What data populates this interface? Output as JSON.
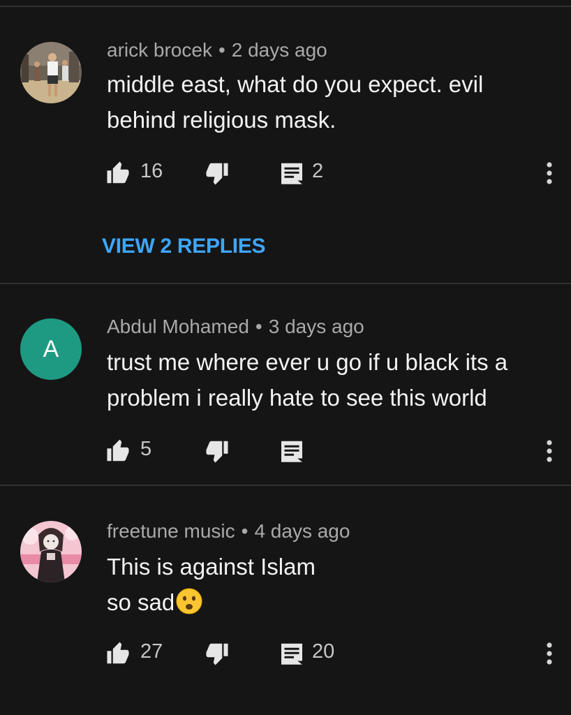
{
  "comments": [
    {
      "author": "arick brocek",
      "separator": "•",
      "time": "2 days ago",
      "text_lines": [
        "middle east, what do you expect. evil",
        "behind religious mask."
      ],
      "likes": "16",
      "replies": "2",
      "avatar_icon": "photo-avatar"
    },
    {
      "author": "Abdul Mohamed",
      "separator": "•",
      "time": "3 days ago",
      "text_lines": [
        "trust me where ever u go if u black its a",
        "problem i really hate to see this world"
      ],
      "likes": "5",
      "replies": "",
      "avatar_letter": "A",
      "avatar_color": "#1e9a83"
    },
    {
      "author": "freetune music",
      "separator": "•",
      "time": "4 days ago",
      "text_lines": [
        "This is against Islam",
        "so sad"
      ],
      "likes": "27",
      "replies": "20",
      "emoji_icon": "frowning-face-emoji",
      "avatar_icon": "anime-photo-avatar"
    }
  ],
  "view_replies_label": "VIEW 2 REPLIES",
  "colors": {
    "background": "#151515",
    "link": "#3ea6ff",
    "meta": "#a9a9a9"
  }
}
